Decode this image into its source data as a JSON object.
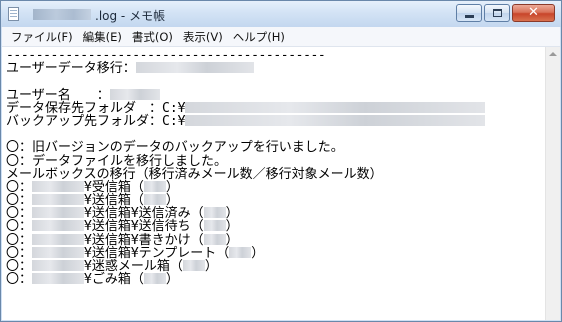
{
  "window": {
    "title_suffix": ".log - メモ帳",
    "minimize_glyph": "",
    "maximize_glyph": "",
    "close_glyph": "✕"
  },
  "menu": {
    "items": [
      "ファイル(F)",
      "編集(E)",
      "書式(O)",
      "表示(V)",
      "ヘルプ(H)"
    ]
  },
  "content": {
    "separator": "-------------------------------------------",
    "migration_label": "ユーザーデータ移行：",
    "user_name_label": "ユーザー名　　：",
    "data_save_folder_label": "データ保存先フォルダ　：C:¥",
    "backup_folder_label": "バックアップ先フォルダ：C:¥",
    "line_backup_done": "〇：旧バージョンのデータのバックアップを行いました。",
    "line_data_migrated": "〇：データファイルを移行しました。",
    "line_mailbox_header": "メールボックスの移行（移行済みメール数／移行対象メール数）",
    "mailbox_prefix": "〇：",
    "mailboxes": [
      "¥受信箱（",
      "¥送信箱（",
      "¥送信箱¥送信済み（",
      "¥送信箱¥送信待ち（",
      "¥送信箱¥書きかけ（",
      "¥送信箱¥テンプレート（",
      "¥迷惑メール箱（",
      "¥ごみ箱（"
    ],
    "close_paren": "）"
  }
}
